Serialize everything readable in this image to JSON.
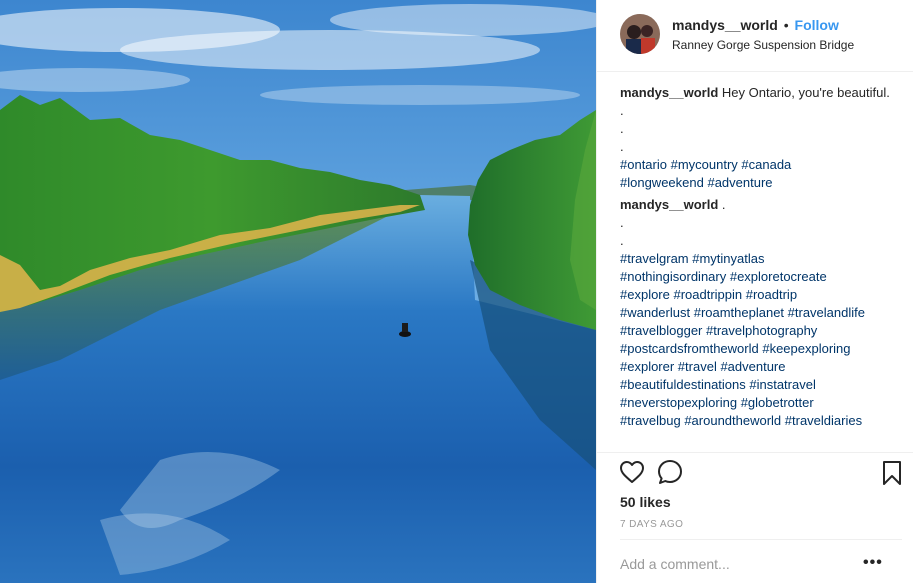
{
  "header": {
    "username": "mandys__world",
    "separator": "•",
    "follow_label": "Follow",
    "location": "Ranney Gorge Suspension Bridge"
  },
  "caption": {
    "username": "mandys__world",
    "text": "Hey Ontario, you're beautiful.",
    "dots": [
      ".",
      ".",
      "."
    ],
    "tag_lines": [
      "#ontario #mycountry #canada",
      "#longweekend #adventure"
    ]
  },
  "comment": {
    "username": "mandys__world",
    "text": ".",
    "dots": [
      ".",
      "."
    ],
    "tag_lines": [
      "#travelgram #mytinyatlas",
      "#nothingisordinary #exploretocreate",
      "#explore #roadtrippin #roadtrip",
      "#wanderlust #roamtheplanet #travelandlife",
      "#travelblogger #travelphotography",
      "#postcardsfromtheworld #keepexploring",
      "#explorer #travel #adventure",
      "#beautifuldestinations #instatravel",
      "#neverstopexploring #globetrotter",
      "#travelbug #aroundtheworld #traveldiaries"
    ]
  },
  "actions": {
    "like_icon": "heart-icon",
    "comment_icon": "speech-bubble-icon",
    "save_icon": "bookmark-icon",
    "likes": "50 likes",
    "age": "7 DAYS AGO",
    "comment_placeholder": "Add a comment...",
    "more_label": "•••"
  },
  "colors": {
    "accent": "#3897f0",
    "hashtag": "#003569",
    "muted": "#999999",
    "text": "#262626"
  }
}
